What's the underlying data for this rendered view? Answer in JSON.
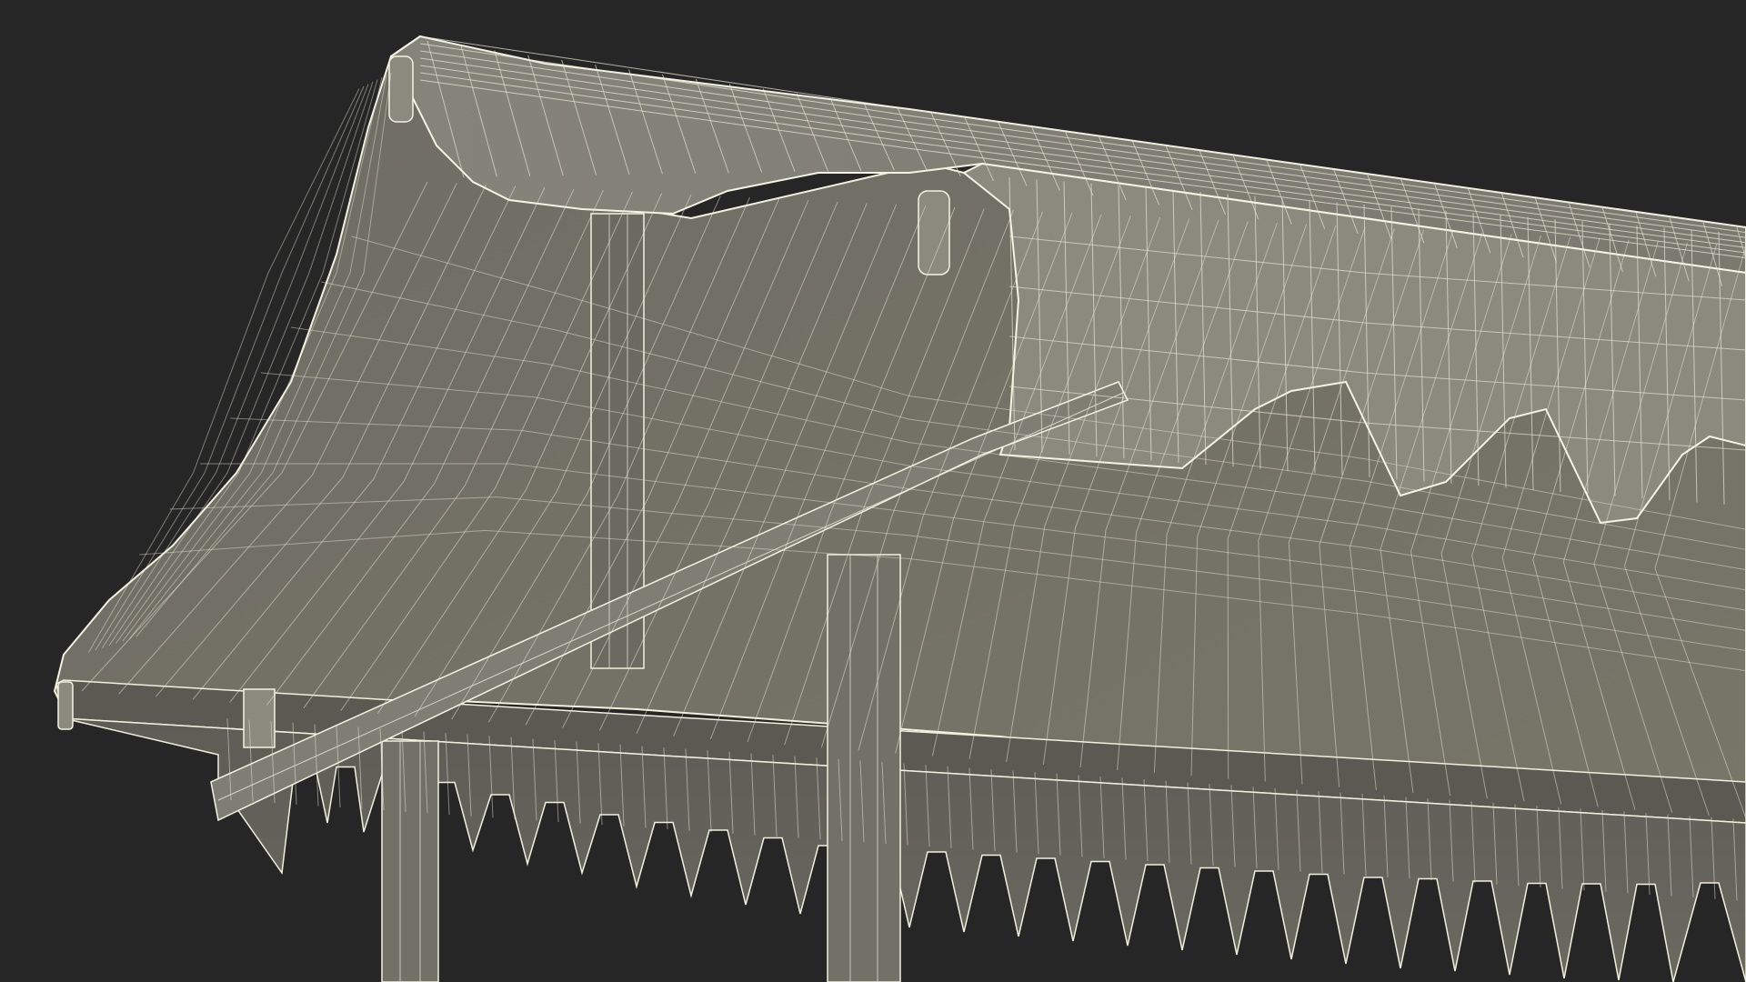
{
  "scene": {
    "background_color": "#262626",
    "surface_color": "#7c7b70",
    "surface_dark_color": "#5f5e56",
    "surface_shadow_color": "#4c4b45",
    "wire_color": "#e9e9d6",
    "edge_color": "#f4f4e2"
  }
}
